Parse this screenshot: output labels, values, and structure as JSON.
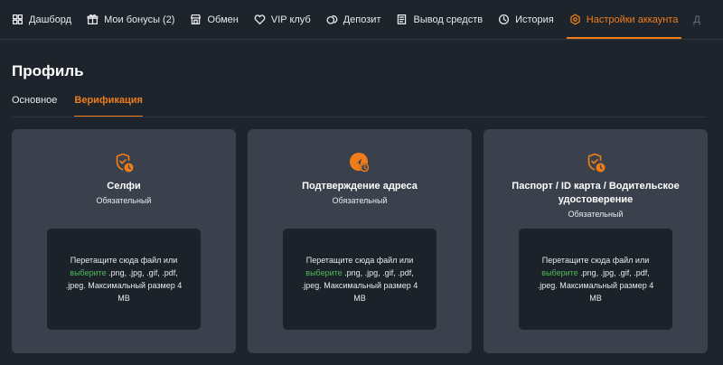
{
  "nav": {
    "items": [
      {
        "label": "Дашборд",
        "icon": "dashboard-icon"
      },
      {
        "label": "Мои бонусы (2)",
        "icon": "gift-icon"
      },
      {
        "label": "Обмен",
        "icon": "store-icon"
      },
      {
        "label": "VIP клуб",
        "icon": "heart-icon"
      },
      {
        "label": "Депозит",
        "icon": "coins-icon"
      },
      {
        "label": "Вывод средств",
        "icon": "wallet-icon"
      },
      {
        "label": "История",
        "icon": "clock-icon"
      },
      {
        "label": "Настройки аккаунта",
        "icon": "settings-icon",
        "active": true
      }
    ],
    "overflow": "Д"
  },
  "page": {
    "title": "Профиль",
    "tabs": [
      {
        "label": "Основное"
      },
      {
        "label": "Верификация",
        "active": true
      }
    ]
  },
  "cards": [
    {
      "title": "Селфи",
      "subtitle": "Обязательный",
      "icon": "shield-clock-icon",
      "drop_before": "Перетащите сюда файл или ",
      "drop_link": "выберите",
      "drop_after": " .png, .jpg, .gif, .pdf, .jpeg. Максимальный размер 4 MB"
    },
    {
      "title": "Подтверждение адреса",
      "subtitle": "Обязательный",
      "icon": "address-clock-icon",
      "drop_before": "Перетащите сюда файл или ",
      "drop_link": "выберите",
      "drop_after": " .png, .jpg, .gif, .pdf, .jpeg. Максимальный размер 4 MB"
    },
    {
      "title": "Паспорт / ID карта / Водительское удостоверение",
      "subtitle": "Обязательный",
      "icon": "shield-clock-icon",
      "drop_before": "Перетащите сюда файл или ",
      "drop_link": "выберите",
      "drop_after": " .png, .jpg, .gif, .pdf, .jpeg. Максимальный размер 4 MB"
    }
  ],
  "colors": {
    "background": "#1e242c",
    "card": "#3a414c",
    "dropzone": "#1c222a",
    "accent": "#f07d1a",
    "link": "#4cbb55"
  }
}
